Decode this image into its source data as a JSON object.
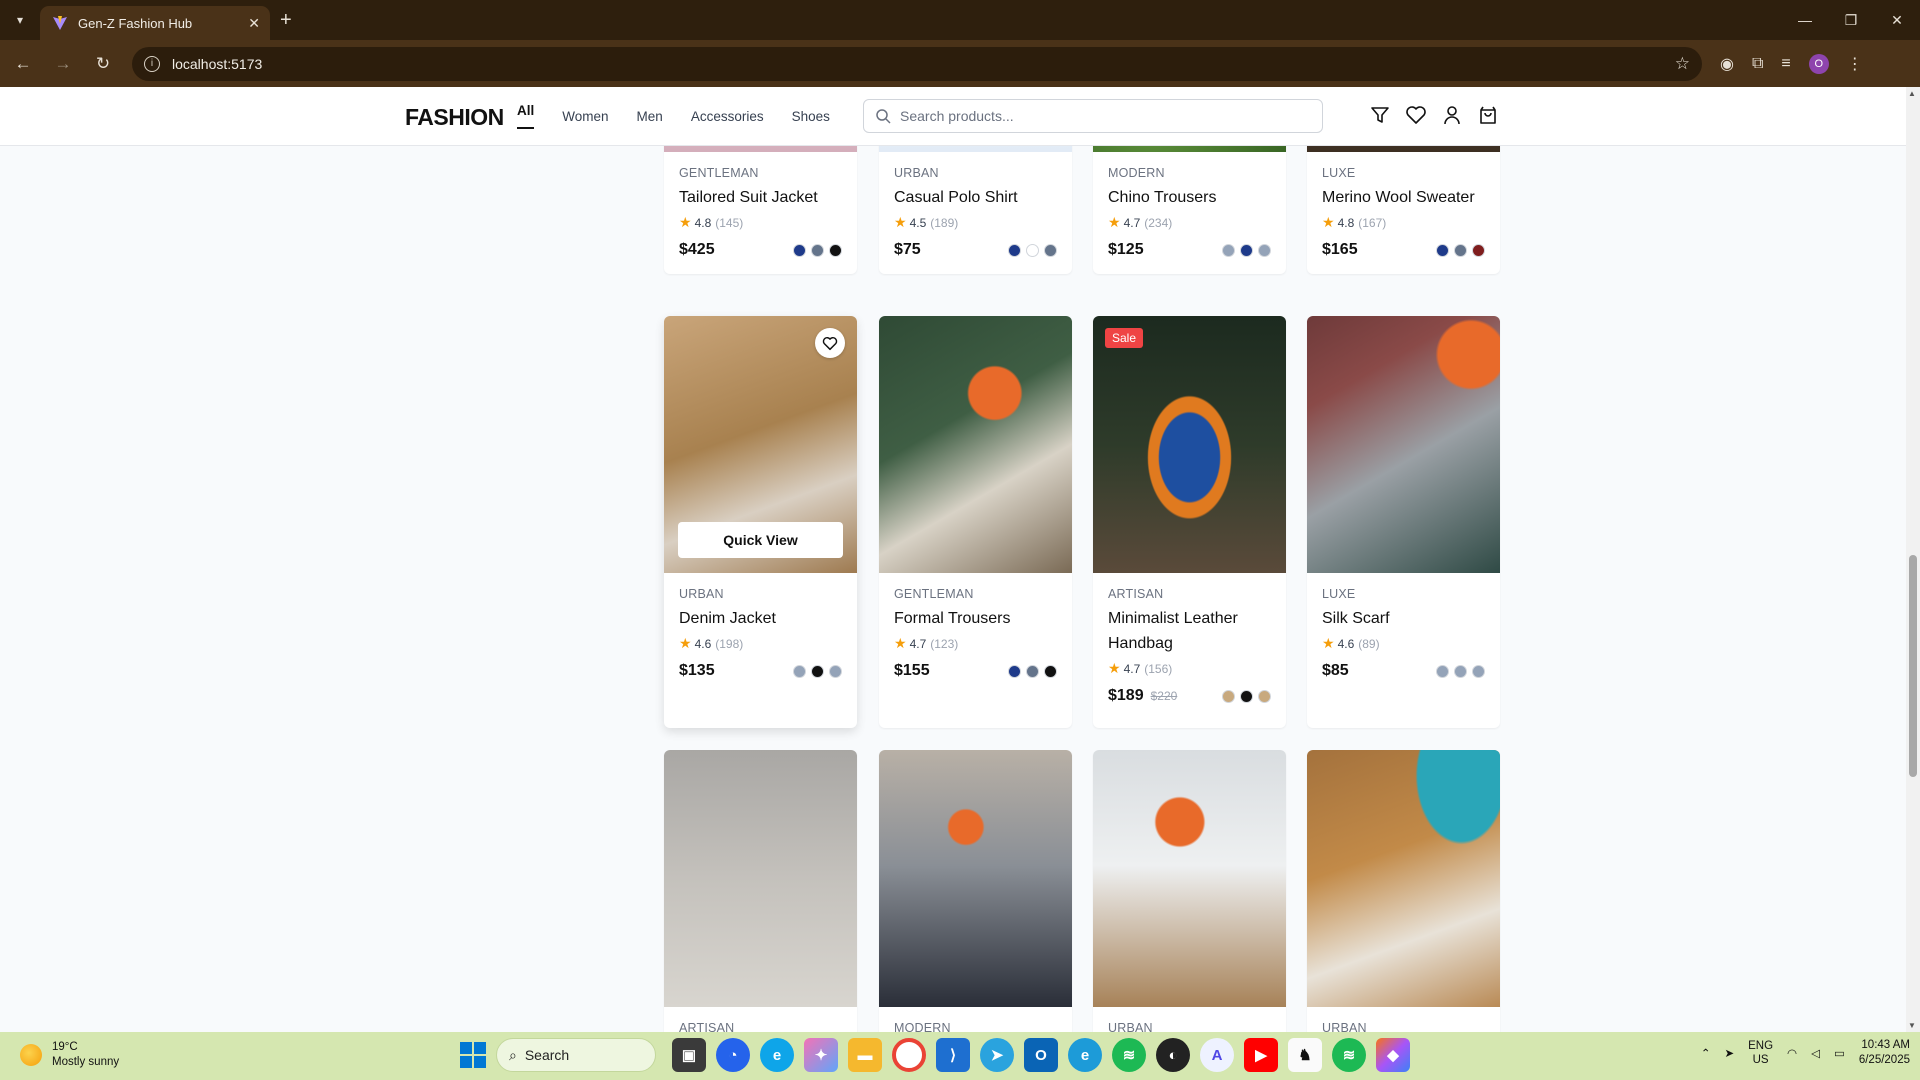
{
  "browser": {
    "tab_title": "Gen-Z Fashion Hub",
    "url": "localhost:5173",
    "profile_initial": "O"
  },
  "header": {
    "logo": "FASHION",
    "nav": [
      "All",
      "Women",
      "Men",
      "Accessories",
      "Shoes"
    ],
    "search_placeholder": "Search products..."
  },
  "products_row1": [
    {
      "brand": "GENTLEMAN",
      "name": "Tailored Suit Jacket",
      "rating": "4.8",
      "reviews": "(145)",
      "price": "$425",
      "colors": [
        "#1e3a8a",
        "#64748b",
        "#111111"
      ],
      "img": "#d9b8c4"
    },
    {
      "brand": "URBAN",
      "name": "Casual Polo Shirt",
      "rating": "4.5",
      "reviews": "(189)",
      "price": "$75",
      "colors": [
        "#1e3a8a",
        "#ffffff",
        "#64748b"
      ],
      "img": "#e6eef8"
    },
    {
      "brand": "MODERN",
      "name": "Chino Trousers",
      "rating": "4.7",
      "reviews": "(234)",
      "price": "$125",
      "colors": [
        "#94a3b8",
        "#1e3a8a",
        "#94a3b8"
      ],
      "img": "#3f6b2a"
    },
    {
      "brand": "LUXE",
      "name": "Merino Wool Sweater",
      "rating": "4.8",
      "reviews": "(167)",
      "price": "$165",
      "colors": [
        "#1e3a8a",
        "#64748b",
        "#7f1d1d"
      ],
      "img": "#4a3a2a"
    }
  ],
  "products_row2": [
    {
      "brand": "URBAN",
      "name": "Denim Jacket",
      "rating": "4.6",
      "reviews": "(198)",
      "price": "$135",
      "colors": [
        "#94a3b8",
        "#111111",
        "#94a3b8"
      ],
      "quick_view": "Quick View"
    },
    {
      "brand": "GENTLEMAN",
      "name": "Formal Trousers",
      "rating": "4.7",
      "reviews": "(123)",
      "price": "$155",
      "colors": [
        "#1e3a8a",
        "#64748b",
        "#111111"
      ]
    },
    {
      "brand": "ARTISAN",
      "name": "Minimalist Leather Handbag",
      "rating": "4.7",
      "reviews": "(156)",
      "price": "$189",
      "original_price": "$220",
      "badge": "Sale",
      "colors": [
        "#c8a97e",
        "#111111",
        "#c8a97e"
      ]
    },
    {
      "brand": "LUXE",
      "name": "Silk Scarf",
      "rating": "4.6",
      "reviews": "(89)",
      "price": "$85",
      "colors": [
        "#94a3b8",
        "#94a3b8",
        "#94a3b8"
      ]
    }
  ],
  "products_row3": [
    {
      "brand": "ARTISAN"
    },
    {
      "brand": "MODERN"
    },
    {
      "brand": "URBAN"
    },
    {
      "brand": "URBAN"
    }
  ],
  "taskbar": {
    "temp": "19°C",
    "weather": "Mostly sunny",
    "search_label": "Search",
    "lang_1": "ENG",
    "lang_2": "US",
    "time": "10:43 AM",
    "date": "6/25/2025"
  }
}
